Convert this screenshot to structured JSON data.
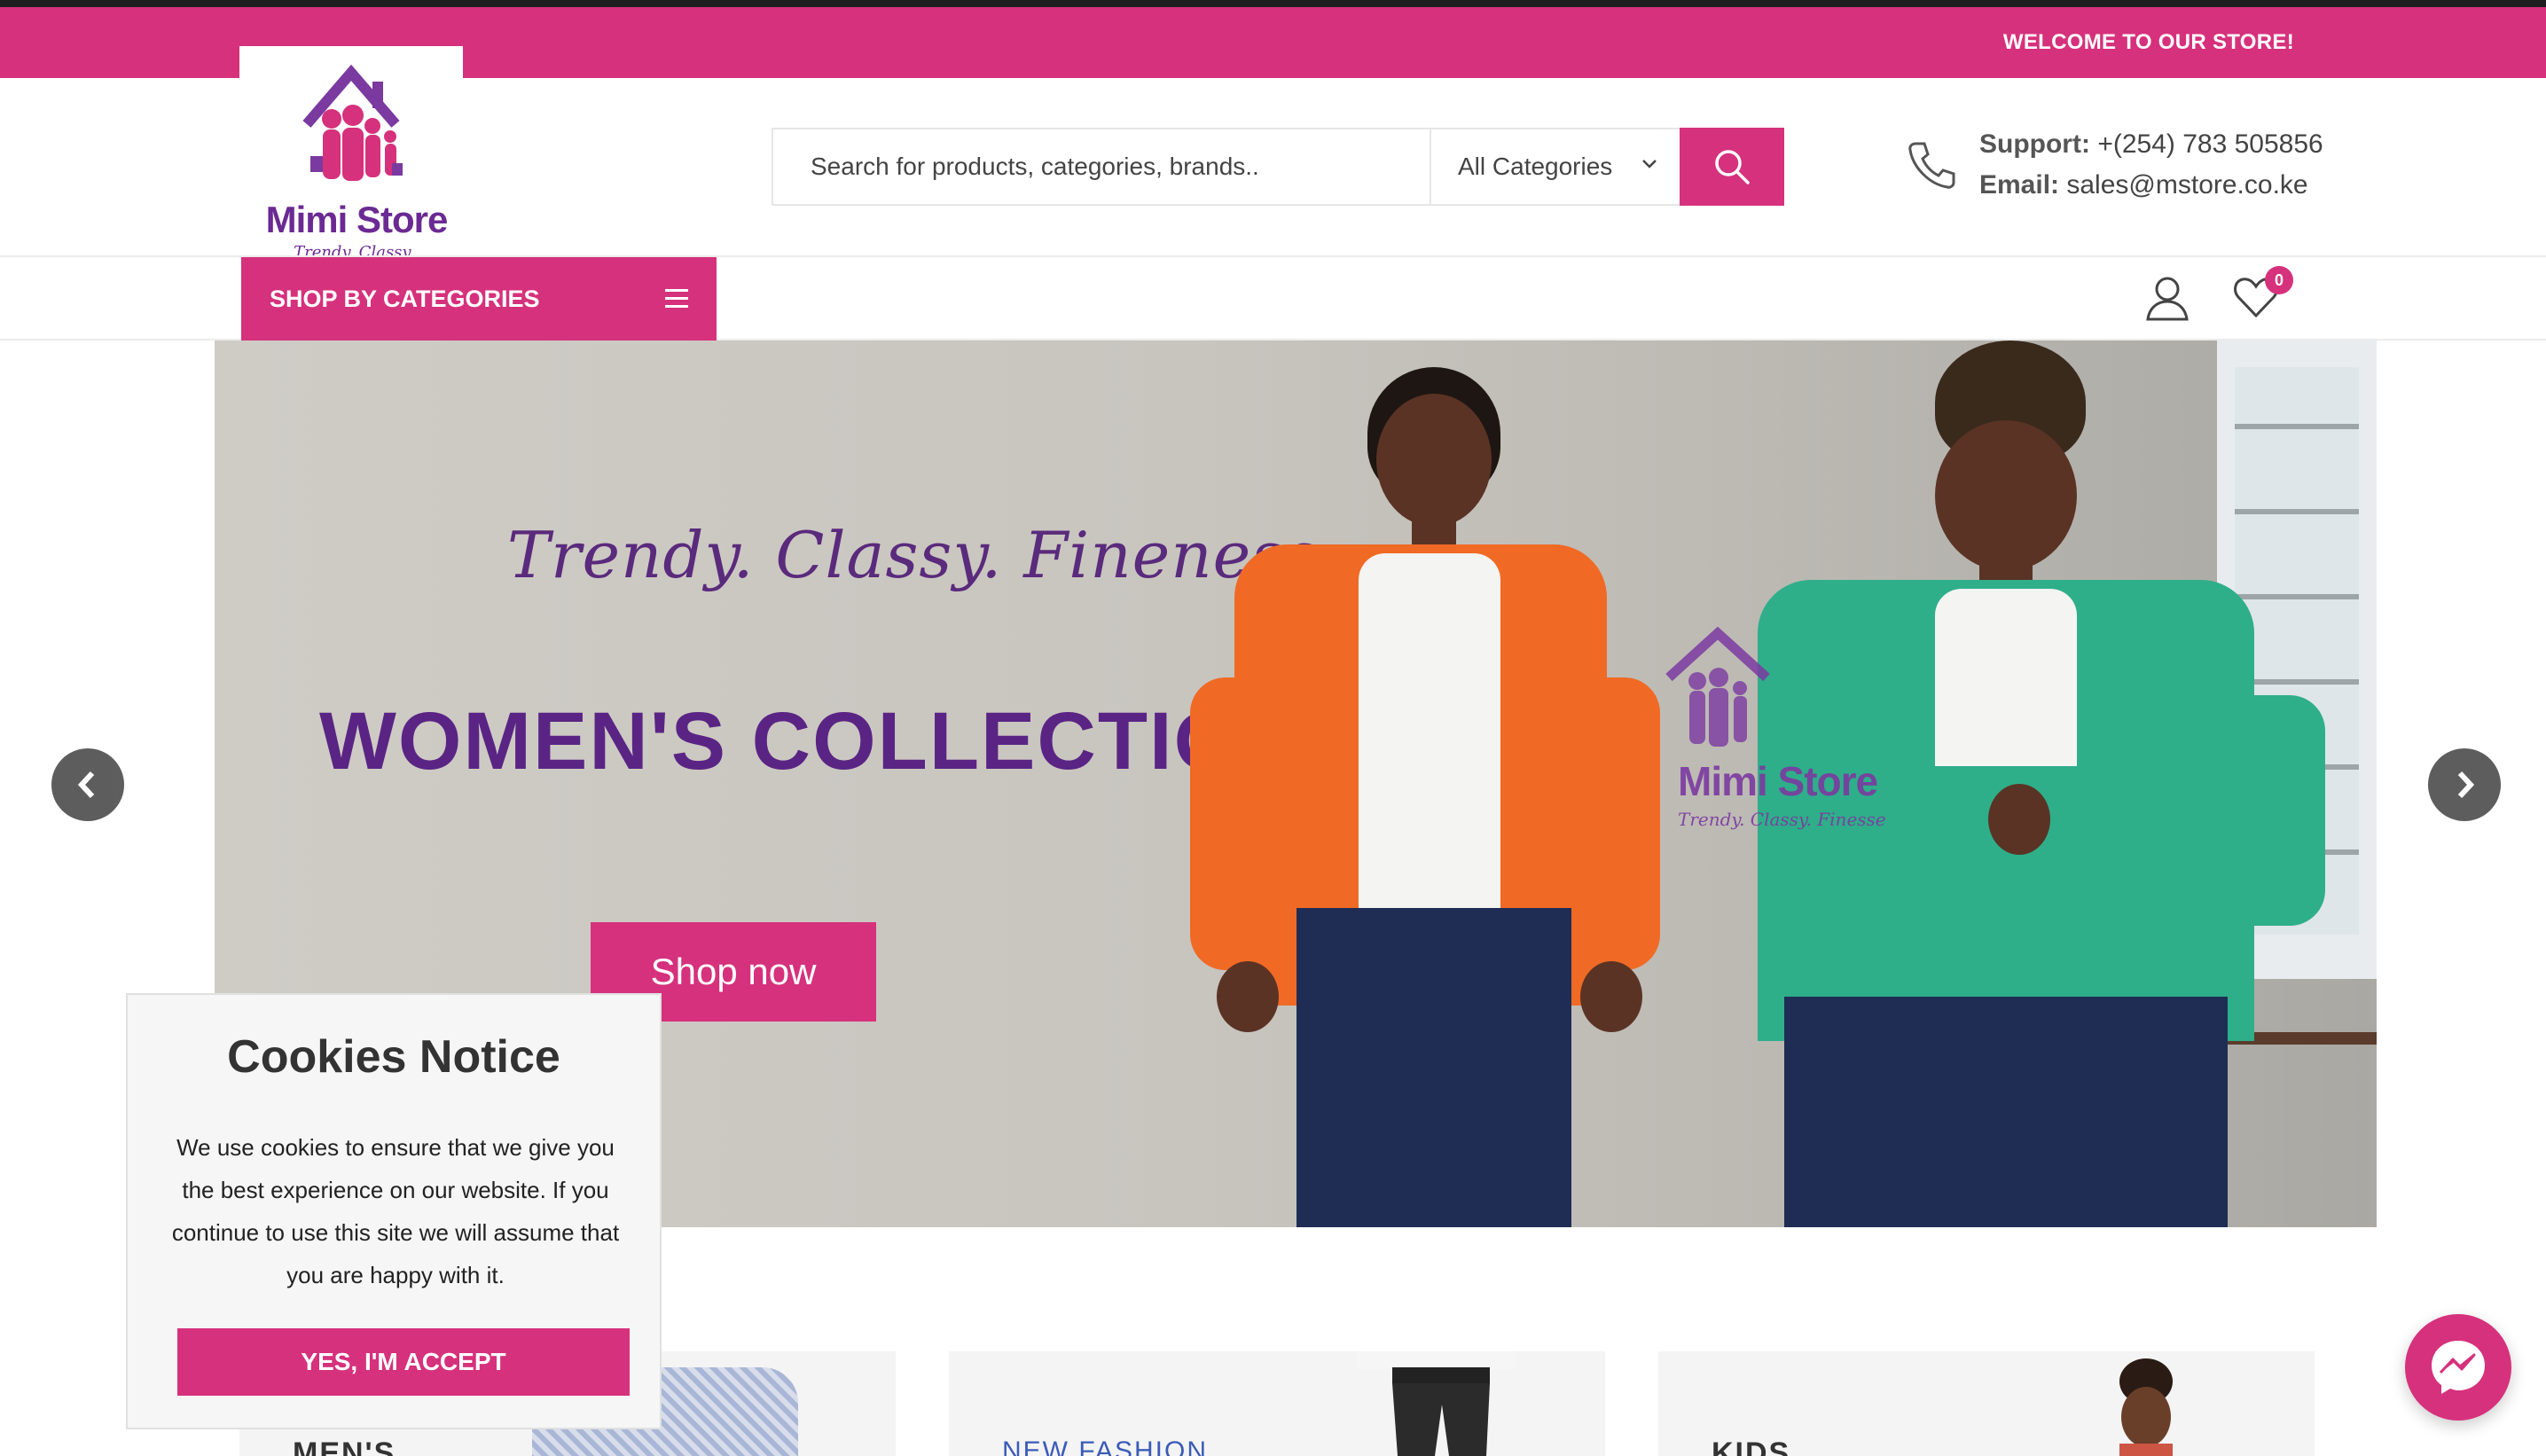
{
  "topbar": {
    "welcome": "WELCOME TO OUR STORE!"
  },
  "logo": {
    "name": "Mimi Store",
    "tagline": "Trendy. Classy. Finesse"
  },
  "search": {
    "placeholder": "Search for products, categories, brands..",
    "category": "All Categories"
  },
  "contact": {
    "support_label": "Support:",
    "support_value": "+(254) 783 505856",
    "email_label": "Email:",
    "email_value": "sales@mstore.co.ke"
  },
  "nav": {
    "shop_by_categories": "SHOP BY CATEGORIES",
    "wishlist_count": "0"
  },
  "hero": {
    "tagline": "Trendy. Classy. Fineness",
    "headline": "WOMEN'S COLLECTIONS",
    "button": "Shop now",
    "watermark_name": "Mimi Store",
    "watermark_tagline": "Trendy. Classy. Finesse"
  },
  "cards": [
    {
      "label": "MEN'S"
    },
    {
      "label": "NEW FASHION"
    },
    {
      "label": "KIDS"
    }
  ],
  "cookies": {
    "title": "Cookies Notice",
    "body": "We use cookies to ensure that we give you the best experience on our website. If you continue to use this site we will assume that you are happy with it.",
    "accept": "YES, I'M ACCEPT"
  },
  "colors": {
    "brand_pink": "#d6317c",
    "brand_purple": "#5a2484"
  }
}
